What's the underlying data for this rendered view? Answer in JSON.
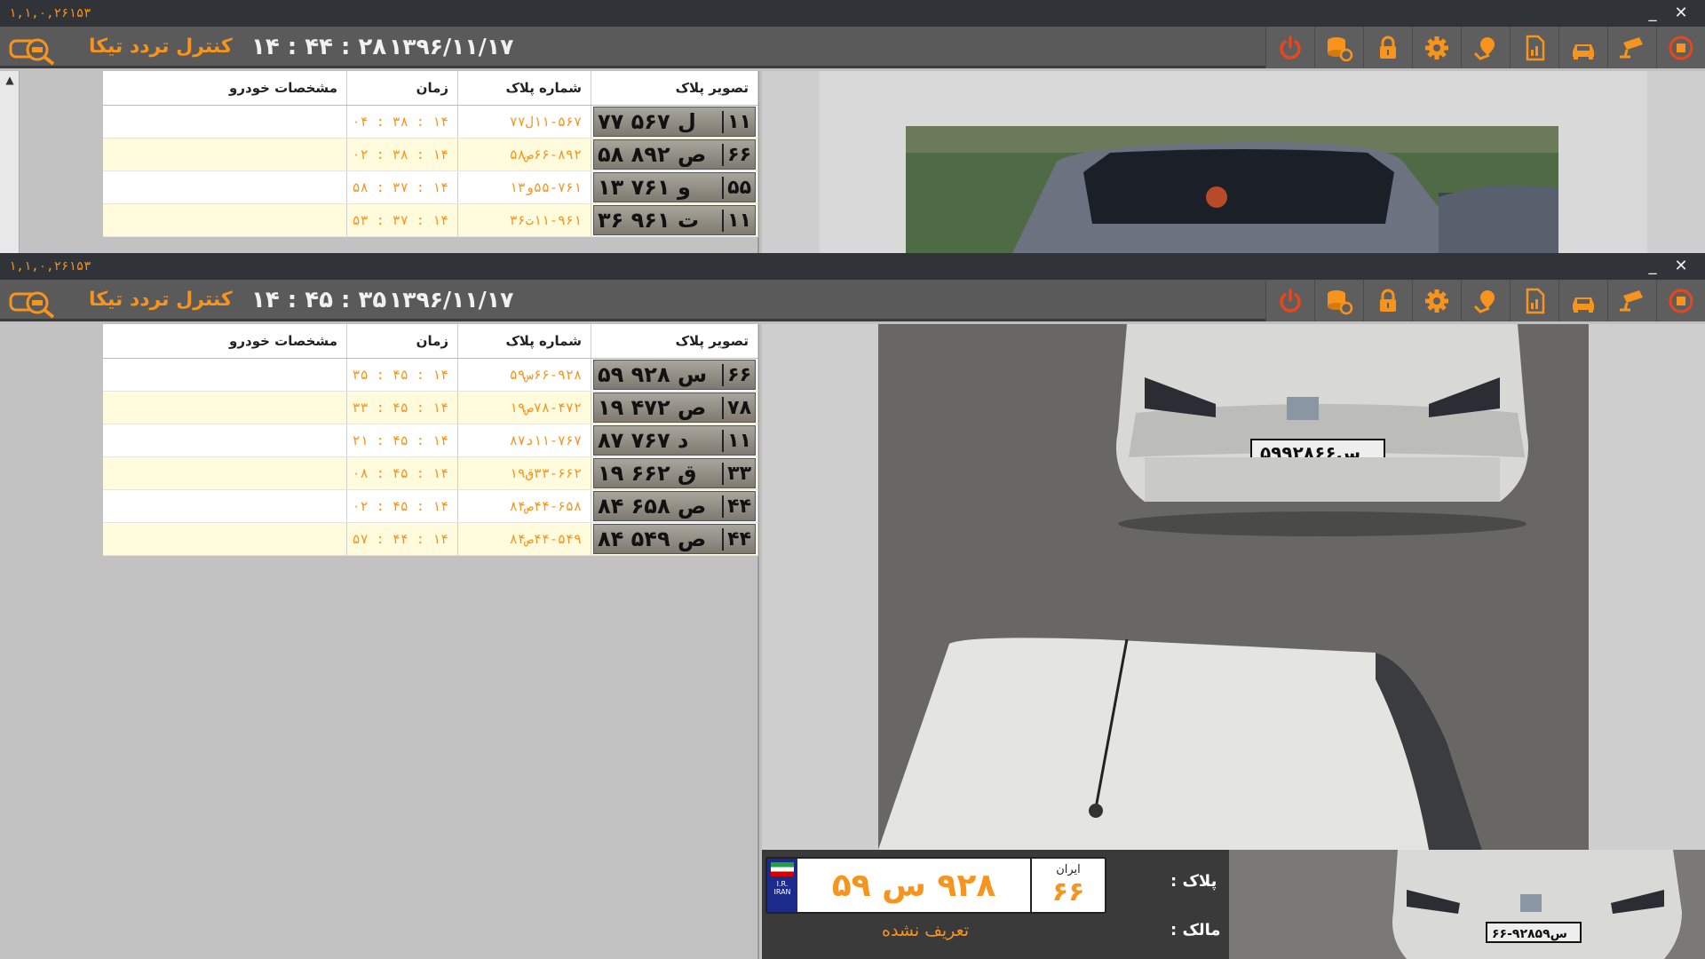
{
  "windows": [
    {
      "version": "۱,۱,۰,۲۶۱۵۳",
      "app_title": "کنترل تردد تیکا",
      "clock": "۱۴ : ۴۴ : ۲۸",
      "date": "۱۳۹۶/۱۱/۱۷",
      "columns": {
        "plate_image": "تصویر پلاک",
        "plate_number": "شماره پلاک",
        "time": "زمان",
        "vehicle": "مشخصات خودرو"
      },
      "rows": [
        {
          "plate_main": "۷۷ ل ۵۶۷",
          "plate_reg": "۱۱",
          "plate_number": "۱۱-۵۶۷ل۷۷",
          "time": "۱۴ : ۳۸ : ۰۴",
          "vehicle": ""
        },
        {
          "plate_main": "۵۸ ص ۸۹۲",
          "plate_reg": "۶۶",
          "plate_number": "۶۶-۸۹۲ص۵۸",
          "time": "۱۴ : ۳۸ : ۰۲",
          "vehicle": ""
        },
        {
          "plate_main": "۱۳ و ۷۶۱",
          "plate_reg": "۵۵",
          "plate_number": "۵۵-۷۶۱و۱۳",
          "time": "۱۴ : ۳۷ : ۵۸",
          "vehicle": ""
        },
        {
          "plate_main": "۳۶ ت ۹۶۱",
          "plate_reg": "۱۱",
          "plate_number": "۱۱-۹۶۱ت۳۶",
          "time": "۱۴ : ۳۷ : ۵۳",
          "vehicle": ""
        }
      ]
    },
    {
      "version": "۱,۱,۰,۲۶۱۵۳",
      "app_title": "کنترل تردد تیکا",
      "clock": "۱۴ : ۴۵ : ۳۵",
      "date": "۱۳۹۶/۱۱/۱۷",
      "columns": {
        "plate_image": "تصویر پلاک",
        "plate_number": "شماره پلاک",
        "time": "زمان",
        "vehicle": "مشخصات خودرو"
      },
      "rows": [
        {
          "plate_main": "۵۹ س ۹۲۸",
          "plate_reg": "۶۶",
          "plate_number": "۶۶-۹۲۸س۵۹",
          "time": "۱۴ : ۴۵ : ۳۵",
          "vehicle": ""
        },
        {
          "plate_main": "۱۹ ص ۴۷۲",
          "plate_reg": "۷۸",
          "plate_number": "۷۸-۴۷۲ص۱۹",
          "time": "۱۴ : ۴۵ : ۳۳",
          "vehicle": ""
        },
        {
          "plate_main": "۸۷ د ۷۶۷",
          "plate_reg": "۱۱",
          "plate_number": "۱۱-۷۶۷د۸۷",
          "time": "۱۴ : ۴۵ : ۲۱",
          "vehicle": ""
        },
        {
          "plate_main": "۱۹ ق ۶۶۲",
          "plate_reg": "۳۳",
          "plate_number": "۳۳-۶۶۲ق۱۹",
          "time": "۱۴ : ۴۵ : ۰۸",
          "vehicle": ""
        },
        {
          "plate_main": "۸۴ ص ۶۵۸",
          "plate_reg": "۴۴",
          "plate_number": "۴۴-۶۵۸ص۸۴",
          "time": "۱۴ : ۴۵ : ۰۲",
          "vehicle": ""
        },
        {
          "plate_main": "۸۴ ص ۵۴۹",
          "plate_reg": "۴۴",
          "plate_number": "۴۴-۵۴۹ص۸۴",
          "time": "۱۴ : ۴۴ : ۵۷",
          "vehicle": ""
        }
      ],
      "detected": {
        "plate_label": "پلاک :",
        "owner_label": "مالک :",
        "plate_main": "۹۲۸ س ۵۹",
        "plate_reg": "۶۶",
        "plate_country": "ایران",
        "flag_text": "I.R.\nIRAN",
        "owner_value": "تعریف نشده",
        "thumb_plate": "۶۶-۹۲۸س۵۹"
      }
    }
  ],
  "toolbar_icons": [
    "power-icon",
    "database-sync-icon",
    "lock-icon",
    "gear-icon",
    "map-pin-icon",
    "report-icon",
    "car-icon",
    "camera-icon",
    "stop-icon"
  ],
  "window_controls": {
    "minimize": "_",
    "close": "✕"
  },
  "colors": {
    "accent": "#f7941d",
    "titlebar": "#303338",
    "toolbar": "#5a5a5a",
    "row_alt": "#fffbdc"
  }
}
